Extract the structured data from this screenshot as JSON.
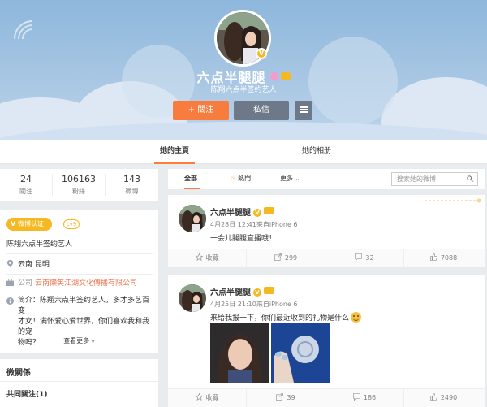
{
  "profile": {
    "name": "六点半腿腿",
    "description": "陈翔六点半签约艺人",
    "follow_label": "+ 關注",
    "message_label": "私信",
    "more_icon": "menu-icon"
  },
  "tabs": [
    {
      "label": "她的主頁",
      "active": true
    },
    {
      "label": "她的相册",
      "active": false
    }
  ],
  "stats": [
    {
      "value": "24",
      "label": "關注"
    },
    {
      "value": "106163",
      "label": "粉絲"
    },
    {
      "value": "143",
      "label": "微博"
    }
  ],
  "info": {
    "verified_badge": "微博认证",
    "level_badge": "Lv9",
    "verified_text": "陈翔六点半签约艺人",
    "location_label": "云南 昆明",
    "company_prefix": "公司",
    "company_link": "云南懶笑江湖文化傳播有限公司",
    "intro_prefix": "简介：",
    "intro_line1": "陈翔六点半签约艺人，多才多艺百变",
    "intro_line2": "才女！满怀爱心爱世界，你们喜欢我和我的宠",
    "intro_line3": "物吗？",
    "see_more": "查看更多"
  },
  "relations": {
    "title": "微關係",
    "common_follow": "共同關注(1)"
  },
  "filter": {
    "all_label": "全部",
    "hot_label": "熱門",
    "more_label": "更多",
    "search_placeholder": "搜索她的微博"
  },
  "posts": [
    {
      "author": "六点半腿腿",
      "meta": "4月28日 12:41來自iPhone 6",
      "text": "一会儿腿腿直播哦！",
      "actions": {
        "fav": "收藏",
        "repost": "299",
        "comment": "32",
        "like": "7088"
      }
    },
    {
      "author": "六点半腿腿",
      "meta": "4月25日 21:10來自iPhone 6",
      "text": "来给我报一下，你们最近收到的礼物是什么",
      "actions": {
        "fav": "收藏",
        "repost": "39",
        "comment": "186",
        "like": "2490"
      }
    }
  ],
  "colors": {
    "accent": "#fa7d3c",
    "follow_button": "#f77c3d",
    "message_button": "#6d7888",
    "verified": "#f6b821",
    "link": "#eb7350"
  }
}
